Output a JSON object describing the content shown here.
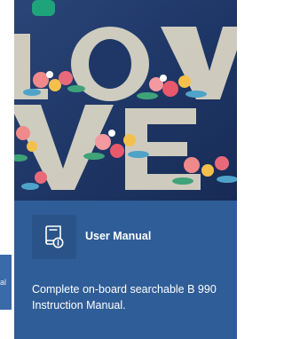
{
  "adjacent_card": {
    "label_fragment": "al"
  },
  "card": {
    "title": "User Manual",
    "description": "Complete on-board searchable B 990 Instruction Manual.",
    "icon": "manual-book-info-icon",
    "hero_image": "embroidered-love-lettering-with-flowers"
  },
  "colors": {
    "card_background": "#2f5d97",
    "icon_box": "#2a5489",
    "text": "#ffffff"
  }
}
